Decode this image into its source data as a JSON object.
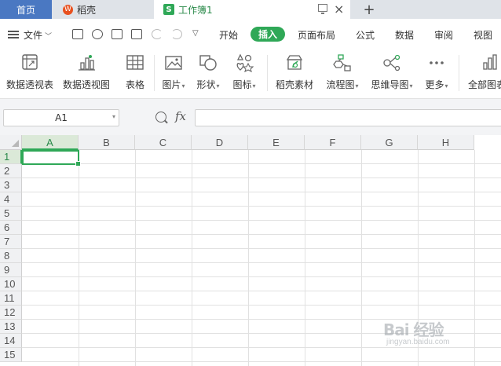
{
  "tabs": {
    "home": "首页",
    "daoke": "稻壳",
    "workbook": "工作簿1",
    "daoke_logo": "W",
    "workbook_logo": "S"
  },
  "menu": {
    "file": "文件",
    "items": [
      "开始",
      "插入",
      "页面布局",
      "公式",
      "数据",
      "审阅",
      "视图"
    ],
    "active": "插入"
  },
  "ribbon": {
    "buttons": [
      {
        "label": "数据透视表",
        "dropdown": false
      },
      {
        "label": "数据透视图",
        "dropdown": false
      },
      {
        "label": "表格",
        "dropdown": false
      },
      {
        "label": "图片",
        "dropdown": true
      },
      {
        "label": "形状",
        "dropdown": true
      },
      {
        "label": "图标",
        "dropdown": true
      },
      {
        "label": "稻壳素材",
        "dropdown": false
      },
      {
        "label": "流程图",
        "dropdown": true
      },
      {
        "label": "思维导图",
        "dropdown": true
      },
      {
        "label": "更多",
        "dropdown": true
      },
      {
        "label": "全部图表",
        "dropdown": false
      }
    ]
  },
  "formula_bar": {
    "name_box": "A1",
    "fx": "fx",
    "value": ""
  },
  "grid": {
    "columns": [
      "A",
      "B",
      "C",
      "D",
      "E",
      "F",
      "G",
      "H"
    ],
    "rows": [
      "1",
      "2",
      "3",
      "4",
      "5",
      "6",
      "7",
      "8",
      "9",
      "10",
      "11",
      "12",
      "13",
      "14",
      "15"
    ],
    "active_cell": "A1"
  },
  "watermark": {
    "text": "Bai 经验",
    "sub": "jingyan.baidu.com"
  },
  "colors": {
    "accent": "#2fa857",
    "home_tab": "#4a78c2"
  }
}
